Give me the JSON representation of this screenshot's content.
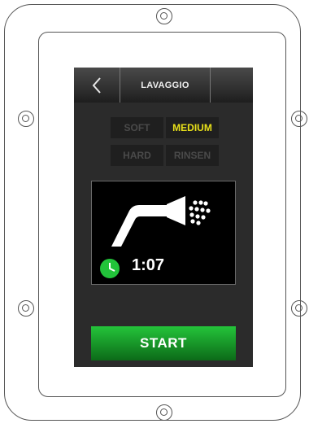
{
  "header": {
    "back_icon": "chevron-left-icon",
    "title": "LAVAGGIO"
  },
  "modes": [
    {
      "label": "SOFT",
      "selected": false
    },
    {
      "label": "MEDIUM",
      "selected": true
    },
    {
      "label": "HARD",
      "selected": false
    },
    {
      "label": "RINSEN",
      "selected": false
    }
  ],
  "cycle": {
    "icon": "spray-nozzle-icon",
    "clock_icon": "clock-icon",
    "time": "1:07"
  },
  "actions": {
    "start_label": "START"
  },
  "colors": {
    "selected_mode": "#e8e01a",
    "start_green": "#1fb232",
    "clock_green": "#22c33a"
  }
}
